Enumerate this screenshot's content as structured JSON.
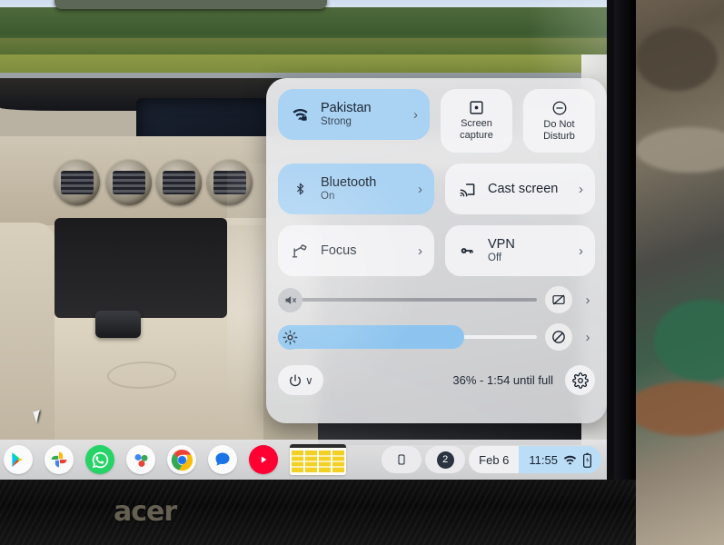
{
  "device": {
    "brand_logo": "acer"
  },
  "wallpaper": {
    "description": "car-interior-photo"
  },
  "quick_settings": {
    "tiles": [
      {
        "name": "wifi",
        "icon": "wifi-lock-icon",
        "title": "Pakistan",
        "subtitle": "Strong",
        "chevron": "›",
        "active": true
      },
      {
        "name": "screen-capture",
        "icon": "screen-capture-icon",
        "label": "Screen capture",
        "active": false
      },
      {
        "name": "do-not-disturb",
        "icon": "do-not-disturb-icon",
        "label": "Do Not Disturb",
        "active": false
      },
      {
        "name": "bluetooth",
        "icon": "bluetooth-icon",
        "title": "Bluetooth",
        "subtitle": "On",
        "chevron": "›",
        "active": true
      },
      {
        "name": "cast-screen",
        "icon": "cast-icon",
        "title": "Cast screen",
        "subtitle": "",
        "chevron": "›",
        "active": false
      },
      {
        "name": "focus",
        "icon": "desk-lamp-icon",
        "title": "Focus",
        "subtitle": "",
        "chevron": "›",
        "active": false
      },
      {
        "name": "vpn",
        "icon": "key-icon",
        "title": "VPN",
        "subtitle": "Off",
        "chevron": "›",
        "active": false
      }
    ],
    "sliders": [
      {
        "name": "volume",
        "icon": "volume-muted-icon",
        "value": 0,
        "end_icon": "mic-muted-icon",
        "chevron": "›"
      },
      {
        "name": "brightness",
        "icon": "brightness-icon",
        "value": 72,
        "end_icon": "night-light-off-icon",
        "chevron": "›"
      }
    ],
    "footer": {
      "power_icon": "power-icon",
      "power_chevron": "∨",
      "battery_status": "36% - 1:54 until full",
      "settings_icon": "gear-icon"
    }
  },
  "shelf": {
    "apps": [
      {
        "name": "play-store",
        "label": "Play Store"
      },
      {
        "name": "google-photos",
        "label": "Photos"
      },
      {
        "name": "whatsapp",
        "label": "WhatsApp"
      },
      {
        "name": "google-meet",
        "label": "Meet"
      },
      {
        "name": "chrome",
        "label": "Chrome"
      },
      {
        "name": "google-messages",
        "label": "Messages"
      },
      {
        "name": "youtube",
        "label": "YouTube"
      },
      {
        "name": "google-sheets",
        "label": "Sheets"
      }
    ],
    "status": {
      "phone_hub_icon": "phone-icon",
      "notification_count": "2",
      "date": "Feb 6",
      "time": "11:55",
      "wifi_icon": "wifi-icon",
      "battery_icon": "battery-charging-icon"
    }
  },
  "colors": {
    "accent_blue": "#a9d2f3",
    "slider_blue": "#8cc4ef",
    "panel_grey": "#d6d7d9",
    "tile_grey": "#f3f3f5",
    "text_dark": "#1b2430"
  }
}
